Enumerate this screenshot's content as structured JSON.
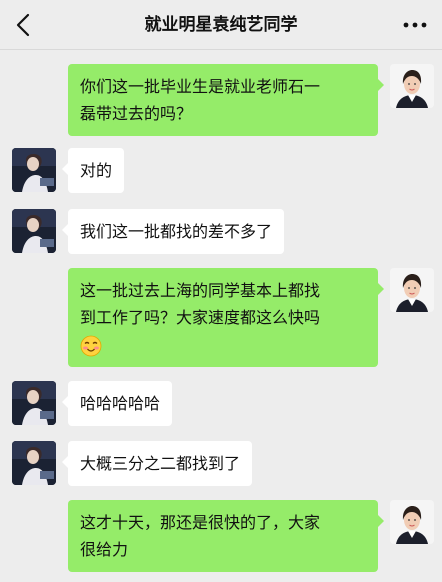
{
  "header": {
    "title": "就业明星袁纯艺同学",
    "back_icon": "chevron-left-icon",
    "more_icon": "more-dots-icon"
  },
  "colors": {
    "background": "#ededed",
    "my_bubble": "#95ec69",
    "other_bubble": "#ffffff"
  },
  "messages": [
    {
      "sender": "me",
      "lines": [
        "你们这一批毕业生是就业老师石一",
        "磊带过去的吗？"
      ]
    },
    {
      "sender": "other",
      "lines": [
        "对的"
      ]
    },
    {
      "sender": "other",
      "lines": [
        "我们这一批都找的差不多了"
      ]
    },
    {
      "sender": "me",
      "lines": [
        "这一批过去上海的同学基本上都找",
        "到工作了吗？大家速度都这么快吗"
      ],
      "emoji": "laughing-blush-emoji"
    },
    {
      "sender": "other",
      "lines": [
        "哈哈哈哈哈"
      ]
    },
    {
      "sender": "other",
      "lines": [
        "大概三分之二都找到了"
      ]
    },
    {
      "sender": "me",
      "lines": [
        "这才十天，那还是很快的了，大家",
        "很给力"
      ]
    }
  ]
}
